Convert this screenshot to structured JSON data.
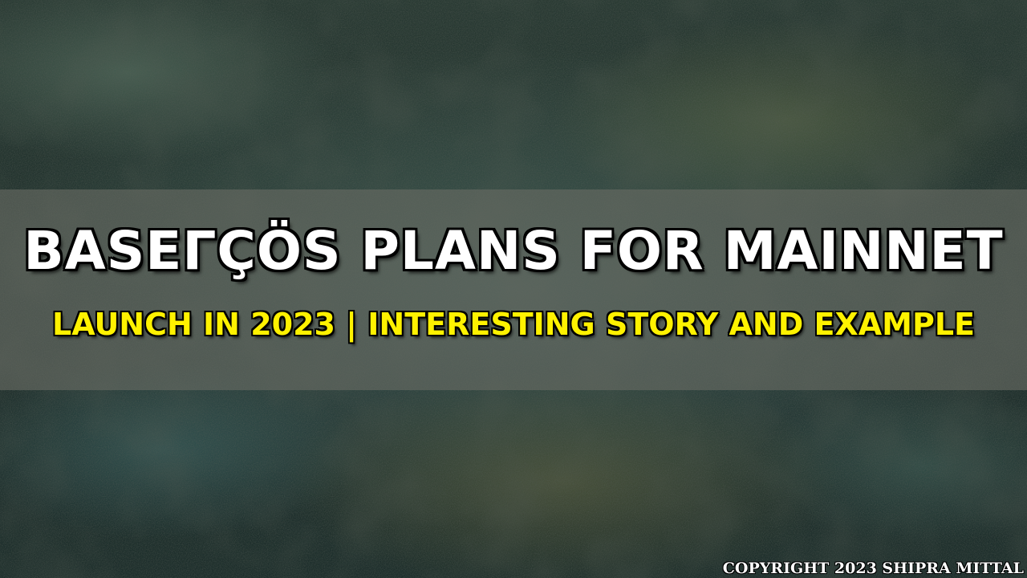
{
  "title_line_1": "BASEΓÇÖS PLANS FOR MAINNET",
  "title_line_2": "LAUNCH IN 2023 | INTERESTING STORY AND EXAMPLE",
  "copyright": "COPYRIGHT 2023 SHIPRA MITTAL",
  "colors": {
    "title": "#ffffff",
    "subtitle": "#fff200",
    "band": "#696c64",
    "background": "#3f5a52"
  }
}
